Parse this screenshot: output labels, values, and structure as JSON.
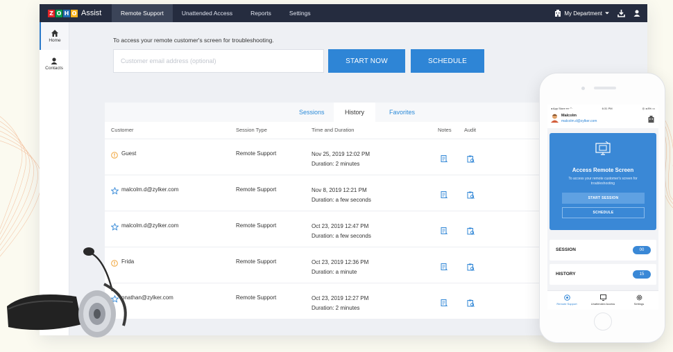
{
  "brand": {
    "logo_letters": [
      "Z",
      "O",
      "H",
      "O"
    ],
    "logo_colors": [
      "#e42527",
      "#089949",
      "#226db4",
      "#f9b21d"
    ],
    "product": "Assist"
  },
  "nav": {
    "items": [
      {
        "label": "Remote Support",
        "active": true
      },
      {
        "label": "Unattended Access",
        "active": false
      },
      {
        "label": "Reports",
        "active": false
      },
      {
        "label": "Settings",
        "active": false
      }
    ],
    "department": "My Department",
    "icons": [
      "building-icon",
      "chevron-down-icon",
      "download-icon",
      "user-icon"
    ]
  },
  "sidebar": {
    "items": [
      {
        "label": "Home",
        "icon": "home-icon",
        "active": true
      },
      {
        "label": "Contacts",
        "icon": "contact-icon",
        "active": false
      }
    ]
  },
  "launch": {
    "description": "To access your remote customer's screen for troubleshooting.",
    "email_placeholder": "Customer email address (optional)",
    "email_value": "",
    "start_label": "START NOW",
    "schedule_label": "SCHEDULE"
  },
  "history": {
    "tabs": [
      {
        "label": "Sessions",
        "active": false
      },
      {
        "label": "History",
        "active": true
      },
      {
        "label": "Favorites",
        "active": false
      }
    ],
    "columns": [
      "Customer",
      "Session Type",
      "Time and Duration",
      "Notes",
      "Audit"
    ],
    "rows": [
      {
        "customer": "Guest",
        "icon": "warning-icon",
        "type": "Remote Support",
        "time": "Nov 25, 2019 12:02 PM",
        "duration": "Duration: 2 minutes"
      },
      {
        "customer": "malcolm.d@zylker.com",
        "icon": "star-outline-icon",
        "type": "Remote Support",
        "time": "Nov 8, 2019 12:21 PM",
        "duration": "Duration: a few seconds"
      },
      {
        "customer": "malcolm.d@zylker.com",
        "icon": "star-outline-icon",
        "type": "Remote Support",
        "time": "Oct 23, 2019 12:47 PM",
        "duration": "Duration: a few seconds"
      },
      {
        "customer": "Frida",
        "icon": "warning-icon",
        "type": "Remote Support",
        "time": "Oct 23, 2019 12:36 PM",
        "duration": "Duration: a minute"
      },
      {
        "customer": "onathan@zylker.com",
        "icon": "star-outline-icon",
        "type": "Remote Support",
        "time": "Oct 23, 2019 12:27 PM",
        "duration": "Duration: 2 minutes"
      }
    ]
  },
  "mobile": {
    "status_left": "◂ App Store ▪▪▪ ◠",
    "status_time": "6:31 PM",
    "status_right": "◎ ◂ 8% ▭",
    "user_name": "Malcolm",
    "user_email": "malcolm.d@zylker.com",
    "card_title": "Access Remote Screen",
    "card_subtitle": "To access your remote customer's screen for troubleshooting",
    "start_label": "START SESSION",
    "schedule_label": "SCHEDULE",
    "lists": [
      {
        "label": "SESSION",
        "count": "00"
      },
      {
        "label": "HISTORY",
        "count": "15"
      }
    ],
    "tabs": [
      "Remote Support",
      "Unattended Access",
      "Settings"
    ]
  },
  "colors": {
    "topbar": "#252c3f",
    "accent": "#2e85d6",
    "warning": "#f0a43a",
    "background": "#fbfaf0"
  }
}
